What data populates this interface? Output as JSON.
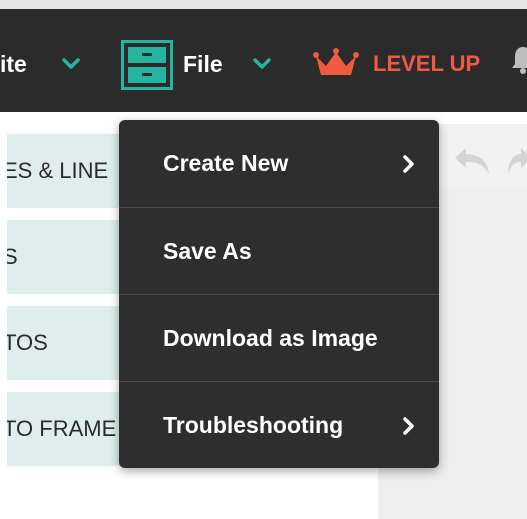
{
  "topbar": {
    "write_label": "ite",
    "file_label": "File",
    "levelup_label": "LEVEL UP"
  },
  "left_panel": {
    "items": [
      {
        "label": "ES & LINE"
      },
      {
        "label": "S"
      },
      {
        "label": "TOS"
      },
      {
        "label": "TO FRAME"
      }
    ]
  },
  "file_menu": {
    "items": [
      {
        "label": "Create New",
        "has_submenu": true
      },
      {
        "label": "Save As",
        "has_submenu": false
      },
      {
        "label": "Download as Image",
        "has_submenu": false
      },
      {
        "label": "Troubleshooting",
        "has_submenu": true
      }
    ]
  },
  "icons": {
    "write_dropdown": "chevron-down-icon",
    "file": "file-cabinet-icon",
    "file_dropdown": "chevron-down-icon",
    "level_up": "crown-icon",
    "notifications": "bell-icon",
    "undo": "undo-icon",
    "redo": "redo-icon",
    "submenu": "chevron-right-icon"
  },
  "colors": {
    "topbar_bg": "#2b2b2b",
    "accent_teal": "#23b5a0",
    "level_up": "#f05a40",
    "menu_bg": "#2e2e2e",
    "menu_divider": "#4a4a4a",
    "panel_item_bg": "#dfeded"
  }
}
